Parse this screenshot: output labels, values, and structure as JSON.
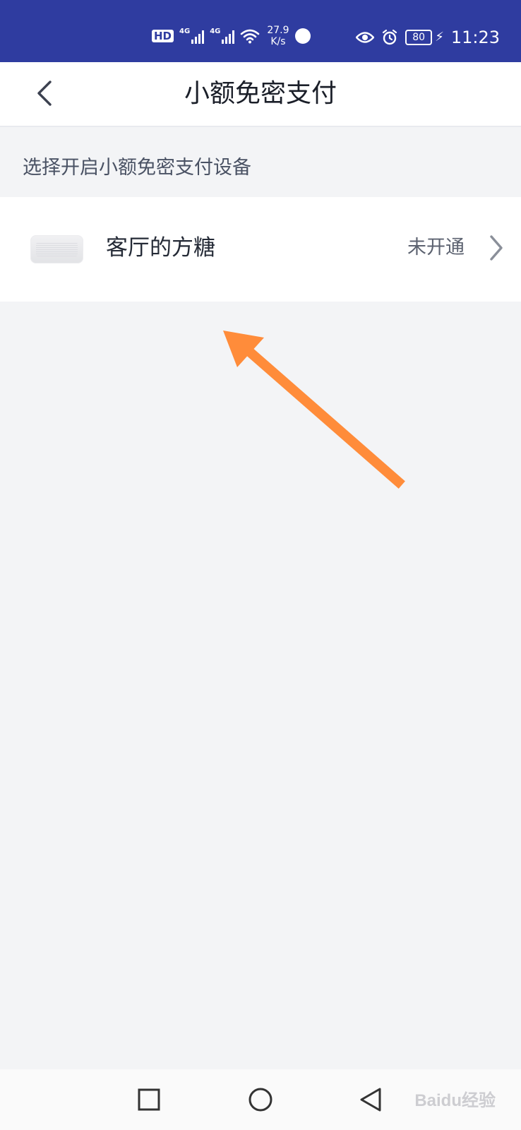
{
  "status_bar": {
    "hd_label": "HD",
    "network_1": "4G",
    "network_2": "4G",
    "speed_value": "27.9",
    "speed_unit": "K/s",
    "battery": "80",
    "time": "11:23"
  },
  "header": {
    "title": "小额免密支付"
  },
  "section": {
    "label": "选择开启小额免密支付设备"
  },
  "device": {
    "name": "客厅的方糖",
    "status": "未开通"
  },
  "annotation": {
    "color": "#ff8c3a"
  },
  "colors": {
    "status_bar_bg": "#2f3ca0",
    "page_bg": "#f3f4f6",
    "row_bg": "#ffffff"
  },
  "watermark": {
    "text": "Baidu经验"
  }
}
